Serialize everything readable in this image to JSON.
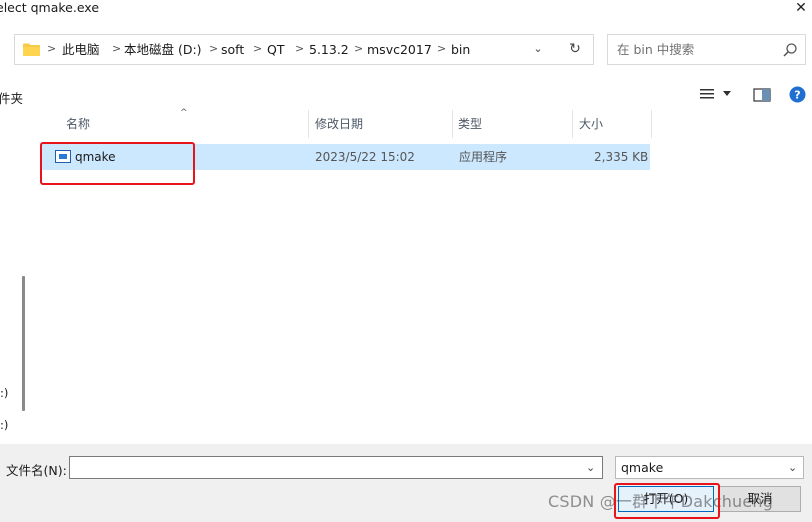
{
  "window": {
    "title": "elect qmake.exe",
    "close_glyph": "✕"
  },
  "address": {
    "crumbs": [
      "此电脑",
      "本地磁盘 (D:)",
      "soft",
      "QT",
      "5.13.2",
      "msvc2017",
      "bin"
    ],
    "separator": ">",
    "dropdown_glyph": "⌄",
    "refresh_glyph": "↻"
  },
  "search": {
    "placeholder": "在 bin 中搜索"
  },
  "toolbar": {
    "new_folder": "件夹",
    "view_glyph": "≣ ▾"
  },
  "nav": {
    "items": [
      ":)",
      ":)"
    ]
  },
  "filelist": {
    "columns": [
      "名称",
      "修改日期",
      "类型",
      "大小"
    ],
    "sort_glyph": "^",
    "rows": [
      {
        "name": "qmake",
        "modified": "2023/5/22 15:02",
        "type": "应用程序",
        "size": "2,335 KB"
      }
    ]
  },
  "bottom": {
    "filename_label": "文件名(N):",
    "filename_value": "",
    "filter_value": "qmake",
    "open_label": "打开(O)",
    "cancel_label": "取消"
  },
  "watermark": "CSDN @一群下午Dakchueng",
  "colors": {
    "selection": "#cce8ff",
    "annotation": "#e8141c",
    "accent": "#0067c0"
  }
}
